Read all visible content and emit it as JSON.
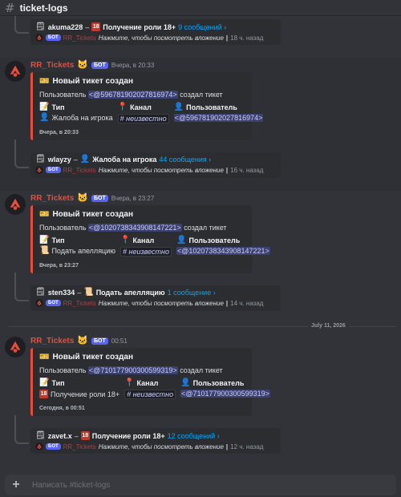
{
  "channel": {
    "name": "ticket-logs",
    "hash_icon": "#"
  },
  "bot": {
    "name": "RR_Tickets",
    "badge": "БОТ",
    "cat_emoji": "🐱"
  },
  "embed_common": {
    "title": "Новый тикет создан",
    "desc_prefix": "Пользователь",
    "desc_suffix": "создал тикет",
    "field_type": "Тип",
    "field_channel": "Канал",
    "field_user": "Пользователь",
    "channel_value": "# неизвестно"
  },
  "thread_common": {
    "hint": "Нажмите, чтобы посмотреть вложение",
    "bot_name": "RR_Tickets",
    "badge": "БОТ"
  },
  "top_thread": {
    "user": "akuma228",
    "topic": "Получение роли 18+",
    "count": "9 сообщений ›",
    "ago": "18 ч. назад"
  },
  "messages": [
    {
      "time": "Вчера, в 20:33",
      "mention": "<@596781902027816974>",
      "type_value": "Жалоба на игрока",
      "user_value": "<@596781902027816974>",
      "footer": "Вчера, в 20:33",
      "thread": {
        "user": "wlayzy",
        "topic": "Жалоба на игрока",
        "count": "44 сообщения ›",
        "ago": "16 ч. назад"
      }
    },
    {
      "time": "Вчера, в 23:27",
      "mention": "<@1020738343908147221>",
      "type_value": "Подать апелляцию",
      "user_value": "<@1020738343908147221>",
      "footer": "Вчера, в 23:27",
      "thread": {
        "user": "sten334",
        "topic": "Подать апелляцию",
        "count": "1 сообщение ›",
        "ago": "14 ч. назад"
      }
    },
    {
      "time": "00:51",
      "mention": "<@710177900300599319>",
      "type_value": "Получение роли 18+",
      "user_value": "<@710177900300599319>",
      "footer": "Сегодня, в 00:51",
      "thread": {
        "user": "zavet.x",
        "topic": "Получение роли 18+",
        "count": "12 сообщений ›",
        "ago": "12 ч. назад"
      }
    }
  ],
  "date_divider": "July 11, 2026",
  "composer": {
    "placeholder": "Написать #ticket-logs",
    "plus": "+"
  },
  "colors": {
    "accent": "#e74c3c",
    "link": "#00a8fc",
    "badge": "#5865f2",
    "mention_bg": "#3c4270"
  }
}
